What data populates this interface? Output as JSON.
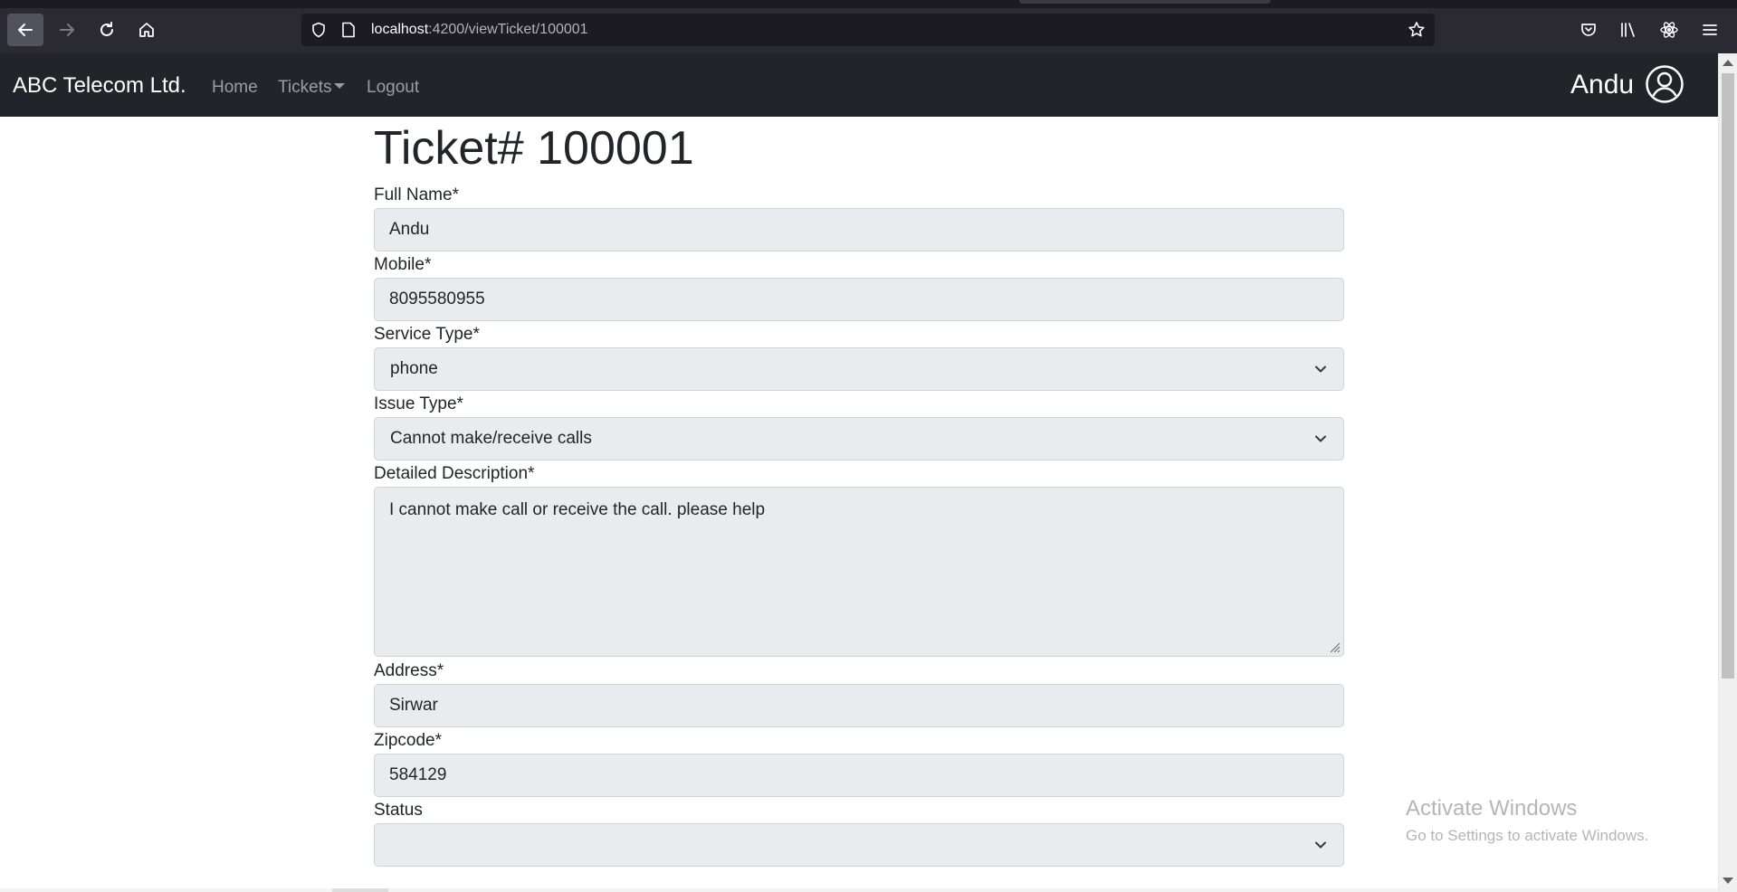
{
  "browser": {
    "url_host": "localhost",
    "url_path": ":4200/viewTicket/100001"
  },
  "navbar": {
    "brand": "ABC Telecom Ltd.",
    "links": [
      "Home",
      "Tickets",
      "Logout"
    ],
    "user_name": "Andu"
  },
  "page": {
    "title": "Ticket# 100001"
  },
  "form": {
    "full_name": {
      "label": "Full Name*",
      "value": "Andu"
    },
    "mobile": {
      "label": "Mobile*",
      "value": "8095580955"
    },
    "service_type": {
      "label": "Service Type*",
      "value": "phone"
    },
    "issue_type": {
      "label": "Issue Type*",
      "value": "Cannot make/receive calls"
    },
    "description": {
      "label": "Detailed Description*",
      "value": "I cannot make call or receive the call. please help"
    },
    "address": {
      "label": "Address*",
      "value": "Sirwar"
    },
    "zipcode": {
      "label": "Zipcode*",
      "value": "584129"
    },
    "status": {
      "label": "Status",
      "value": ""
    }
  },
  "watermark": {
    "line1": "Activate Windows",
    "line2": "Go to Settings to activate Windows."
  },
  "colors": {
    "navbar_bg": "#212529",
    "field_bg": "#e9ecef",
    "browser_bg": "#2b2a33"
  },
  "icons": [
    "back-arrow-icon",
    "forward-arrow-icon",
    "reload-icon",
    "home-icon",
    "shield-icon",
    "page-icon",
    "star-icon",
    "pocket-icon",
    "library-icon",
    "extension-icon",
    "menu-icon",
    "user-circle-icon",
    "chevron-down-icon",
    "resize-grip-icon"
  ]
}
